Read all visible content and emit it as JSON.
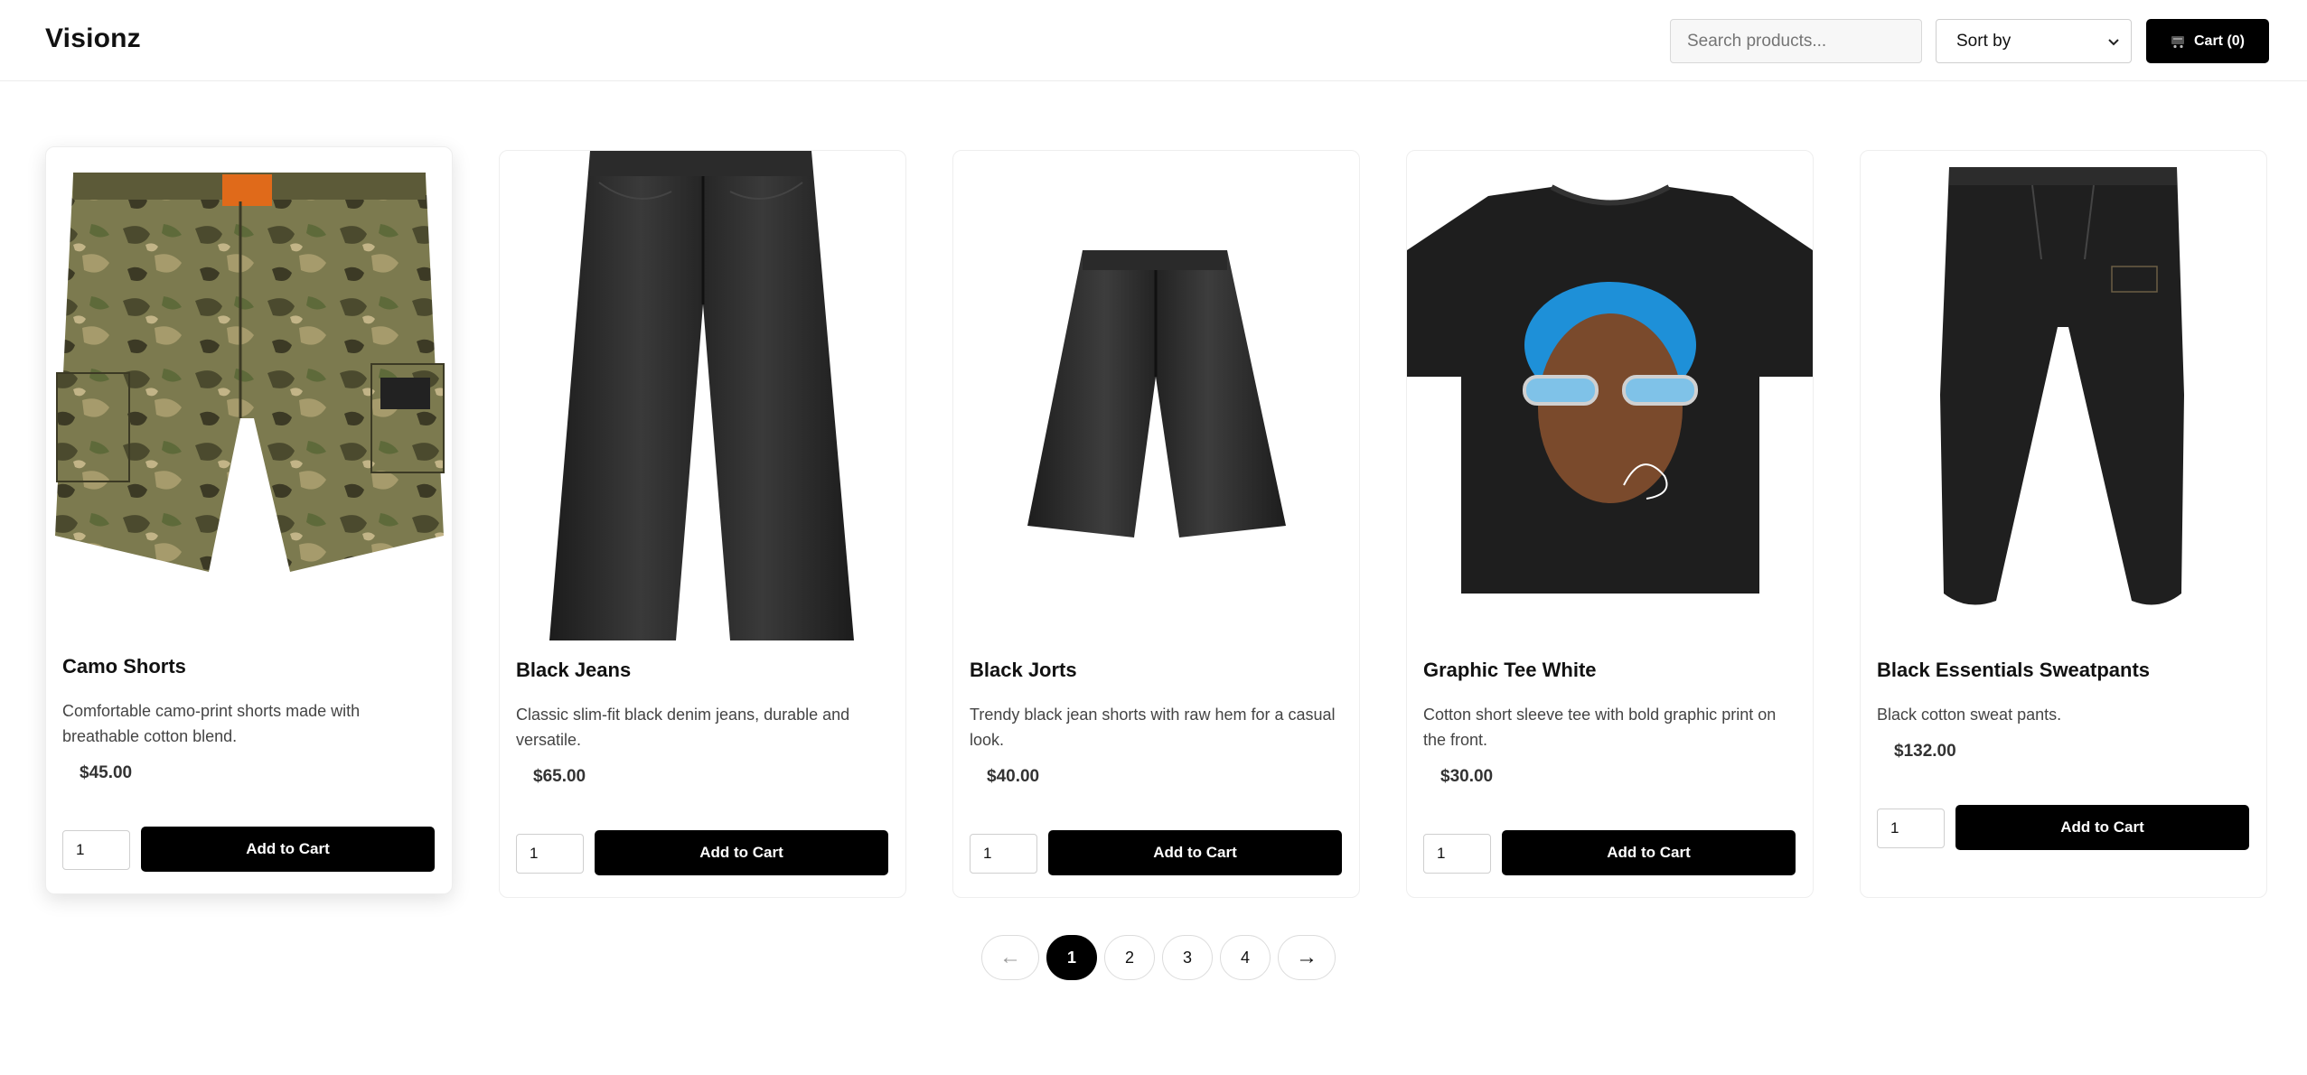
{
  "header": {
    "brand": "Visionz",
    "search_placeholder": "Search products...",
    "sort_label": "Sort by",
    "cart_label": "Cart (0)"
  },
  "products": [
    {
      "name": "Camo Shorts",
      "description": "Comfortable camo-print shorts made with breathable cotton blend.",
      "price": "$45.00",
      "qty": "1",
      "button": "Add to Cart",
      "image_icon": "camo-shorts-image"
    },
    {
      "name": "Black Jeans",
      "description": "Classic slim-fit black denim jeans, durable and versatile.",
      "price": "$65.00",
      "qty": "1",
      "button": "Add to Cart",
      "image_icon": "black-jeans-image"
    },
    {
      "name": "Black Jorts",
      "description": "Trendy black jean shorts with raw hem for a casual look.",
      "price": "$40.00",
      "qty": "1",
      "button": "Add to Cart",
      "image_icon": "black-jorts-image"
    },
    {
      "name": "Graphic Tee White",
      "description": "Cotton short sleeve tee with bold graphic print on the front.",
      "price": "$30.00",
      "qty": "1",
      "button": "Add to Cart",
      "image_icon": "graphic-tee-image"
    },
    {
      "name": "Black Essentials Sweatpants",
      "description": "Black cotton sweat pants.",
      "price": "$132.00",
      "qty": "1",
      "button": "Add to Cart",
      "image_icon": "sweatpants-image"
    }
  ],
  "pagination": {
    "prev": "←",
    "next": "→",
    "pages": [
      "1",
      "2",
      "3",
      "4"
    ],
    "current": "1"
  },
  "colors": {
    "primary": "#000000",
    "background": "#ffffff",
    "border": "#eeeeee",
    "camo_1": "#6b6a45",
    "camo_2": "#4a4a30",
    "denim_black": "#2a2a2a"
  }
}
